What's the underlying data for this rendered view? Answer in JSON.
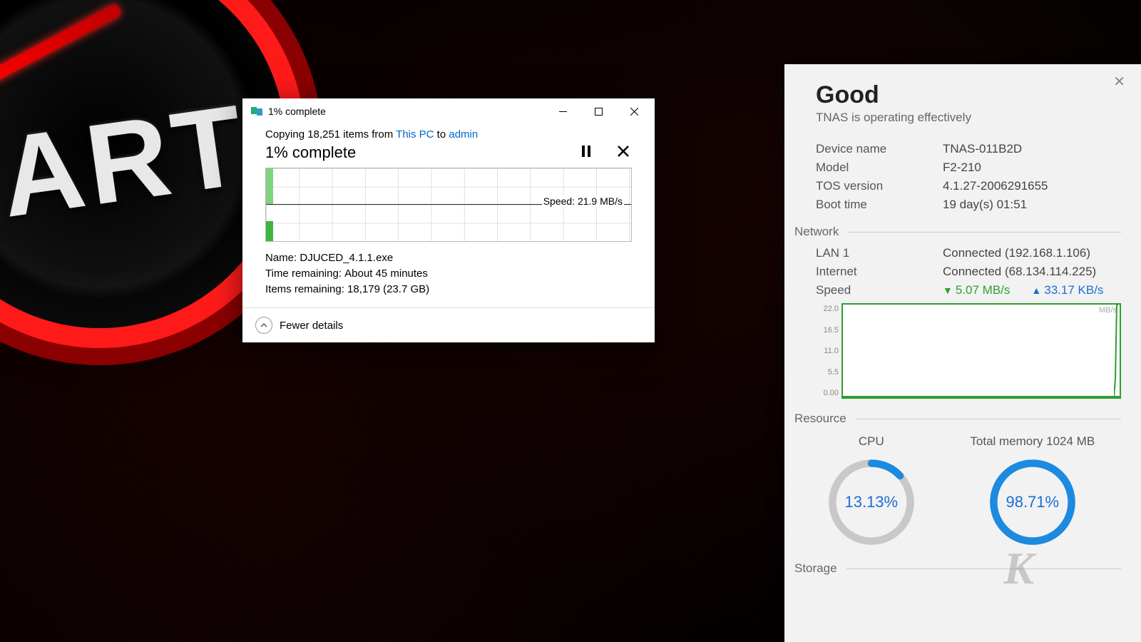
{
  "desktop": {
    "start_label": "ART"
  },
  "copy_dialog": {
    "title": "1% complete",
    "copying_prefix": "Copying 18,251 items from ",
    "src": "This PC",
    "copying_mid": " to ",
    "dst": "admin",
    "percent": "1% complete",
    "speed": "Speed: 21.9 MB/s",
    "name_label": "Name:",
    "name_value": "DJUCED_4.1.1.exe",
    "time_label": "Time remaining:",
    "time_value": "About 45 minutes",
    "items_label": "Items remaining:",
    "items_value": "18,179 (23.7 GB)",
    "fewer_details": "Fewer details"
  },
  "tnas": {
    "status_title": "Good",
    "status_sub": "TNAS is operating effectively",
    "device": {
      "k": "Device name",
      "v": "TNAS-011B2D"
    },
    "model": {
      "k": "Model",
      "v": "F2-210"
    },
    "tos": {
      "k": "TOS version",
      "v": "4.1.27-2006291655"
    },
    "boot": {
      "k": "Boot time",
      "v": "19 day(s) 01:51"
    },
    "section_network": "Network",
    "lan": {
      "k": "LAN 1",
      "v": "Connected (192.168.1.106)"
    },
    "internet": {
      "k": "Internet",
      "v": "Connected (68.134.114.225)"
    },
    "speed_label": "Speed",
    "speed_down": "5.07 MB/s",
    "speed_up": "33.17 KB/s",
    "net_unit": "MB/s",
    "net_y": [
      "22.0",
      "16.5",
      "11.0",
      "5.5",
      "0.00"
    ],
    "section_resource": "Resource",
    "cpu_title": "CPU",
    "cpu_pct_text": "13.13%",
    "cpu_pct": 13.13,
    "mem_title": "Total memory 1024 MB",
    "mem_pct_text": "98.71%",
    "mem_pct": 98.71,
    "section_storage": "Storage"
  },
  "chart_data": [
    {
      "type": "line",
      "title": "File copy transfer speed",
      "ylabel": "MB/s",
      "ylim": [
        0,
        44
      ],
      "x": [
        0,
        1,
        2,
        3,
        4,
        5,
        6,
        7,
        8,
        9,
        10,
        11
      ],
      "values": [
        21.9,
        21.9,
        21.9,
        21.9,
        21.9,
        21.9,
        21.9,
        21.9,
        21.9,
        21.9,
        21.9,
        21.9
      ],
      "annotation": "Speed: 21.9 MB/s"
    },
    {
      "type": "line",
      "title": "TNAS network throughput",
      "ylabel": "MB/s",
      "ylim": [
        0,
        22
      ],
      "yticks": [
        0,
        5.5,
        11.0,
        16.5,
        22.0
      ],
      "x": [
        0,
        1,
        2,
        3,
        4,
        5,
        6,
        7,
        8,
        9,
        10,
        11,
        12,
        13,
        14,
        15,
        16,
        17,
        18,
        19
      ],
      "values": [
        0,
        0,
        0,
        0,
        0,
        0,
        0,
        0,
        0,
        0,
        0,
        0,
        0,
        0,
        0,
        0,
        0,
        0,
        5,
        22
      ]
    }
  ]
}
